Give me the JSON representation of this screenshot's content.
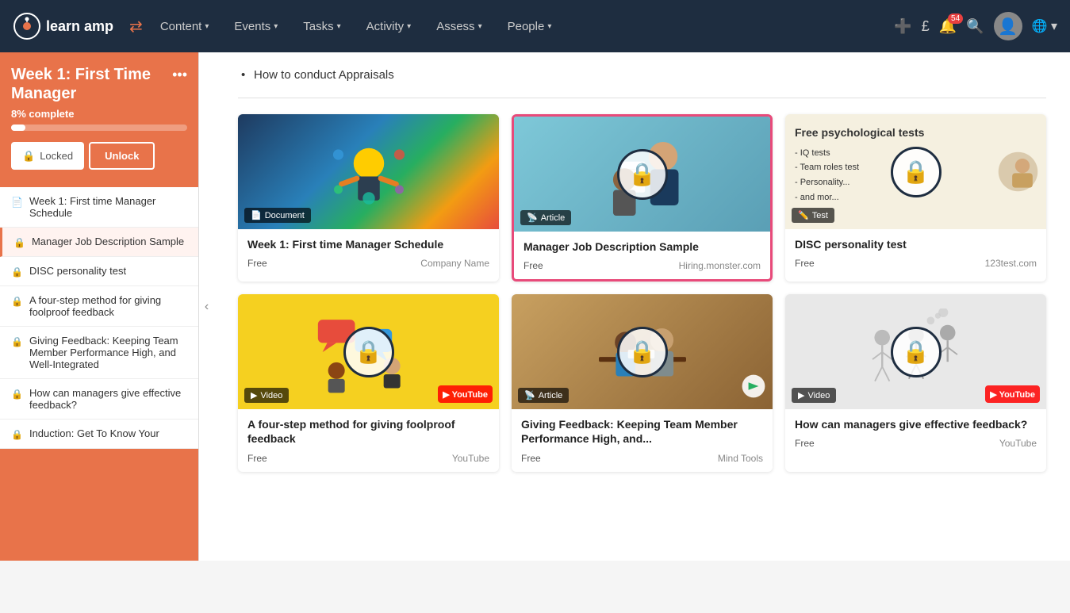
{
  "nav": {
    "logo_text": "learn amp",
    "items": [
      {
        "label": "Content",
        "has_dropdown": true
      },
      {
        "label": "Events",
        "has_dropdown": true
      },
      {
        "label": "Tasks",
        "has_dropdown": true
      },
      {
        "label": "Activity",
        "has_dropdown": true
      },
      {
        "label": "Assess",
        "has_dropdown": true
      },
      {
        "label": "People",
        "has_dropdown": true
      }
    ],
    "bell_count": "54"
  },
  "sidebar": {
    "title": "Week 1: First Time Manager",
    "progress_label": "8% complete",
    "progress_percent": 8,
    "btn_locked": "Locked",
    "btn_unlock": "Unlock",
    "items": [
      {
        "id": "item1",
        "icon": "doc",
        "label": "Week 1: First time Manager Schedule",
        "locked": false,
        "active": false
      },
      {
        "id": "item2",
        "icon": "lock",
        "label": "Manager Job Description Sample",
        "locked": true,
        "active": true
      },
      {
        "id": "item3",
        "icon": "lock",
        "label": "DISC personality test",
        "locked": true,
        "active": false
      },
      {
        "id": "item4",
        "icon": "lock",
        "label": "A four-step method for giving foolproof feedback",
        "locked": true,
        "active": false
      },
      {
        "id": "item5",
        "icon": "lock",
        "label": "Giving Feedback: Keeping Team Member Performance High, and Well-Integrated",
        "locked": true,
        "active": false
      },
      {
        "id": "item6",
        "icon": "lock",
        "label": "How can managers give effective feedback?",
        "locked": true,
        "active": false
      },
      {
        "id": "item7",
        "icon": "lock",
        "label": "Induction: Get To Know Your",
        "locked": true,
        "active": false
      }
    ]
  },
  "main": {
    "bullet": "How to conduct Appraisals",
    "cards_row1": [
      {
        "type": "Document",
        "type_icon": "📄",
        "title": "Week 1: First time Manager Schedule",
        "free": "Free",
        "source": "Company Name",
        "locked": false,
        "selected": false,
        "thumb_style": "colorful-doc"
      },
      {
        "type": "Article",
        "type_icon": "📡",
        "title": "Manager Job Description Sample",
        "free": "Free",
        "source": "Hiring.monster.com",
        "locked": true,
        "selected": true,
        "thumb_style": "manager-img"
      },
      {
        "type": "Test",
        "type_icon": "✏️",
        "title": "DISC personality test",
        "free": "Free",
        "source": "123test.com",
        "locked": true,
        "selected": false,
        "thumb_style": "psych-thumb"
      }
    ],
    "cards_row2": [
      {
        "type": "Video",
        "type_icon": "▶",
        "title": "A four-step method for giving foolproof feedback",
        "free": "Free",
        "source": "YouTube",
        "locked": true,
        "selected": false,
        "thumb_style": "feedback-thumb"
      },
      {
        "type": "Article",
        "type_icon": "📡",
        "title": "Giving Feedback: Keeping Team Member Performance High, and...",
        "free": "Free",
        "source": "Mind Tools",
        "locked": true,
        "selected": false,
        "thumb_style": "article-office"
      },
      {
        "type": "Video",
        "type_icon": "▶",
        "title": "How can managers give effective feedback?",
        "free": "Free",
        "source": "YouTube",
        "locked": true,
        "selected": false,
        "thumb_style": "video-cartoon"
      }
    ]
  }
}
